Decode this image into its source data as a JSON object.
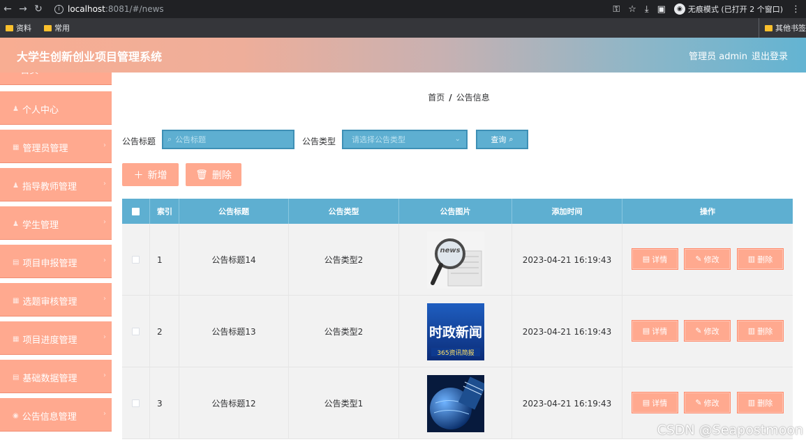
{
  "browser": {
    "url_host": "localhost",
    "url_path": ":8081/#/news",
    "incognito_label": "无痕模式 (已打开 2 个窗口)",
    "bookmarks": [
      "资料",
      "常用"
    ],
    "bookmarks_right": "其他书签"
  },
  "header": {
    "title": "大学生创新创业项目管理系统",
    "user": "管理员 admin",
    "logout": "退出登录"
  },
  "sidebar": {
    "items": [
      {
        "label": "首页",
        "icon": "home-icon"
      },
      {
        "label": "个人中心",
        "icon": "user-icon"
      },
      {
        "label": "管理员管理",
        "icon": "grid-icon"
      },
      {
        "label": "指导教师管理",
        "icon": "user-icon"
      },
      {
        "label": "学生管理",
        "icon": "user-icon"
      },
      {
        "label": "项目申报管理",
        "icon": "file-icon"
      },
      {
        "label": "选题审核管理",
        "icon": "grid-icon"
      },
      {
        "label": "项目进度管理",
        "icon": "grid-icon"
      },
      {
        "label": "基础数据管理",
        "icon": "file-icon"
      },
      {
        "label": "公告信息管理",
        "icon": "bell-icon"
      }
    ]
  },
  "breadcrumb": {
    "home": "首页",
    "sep": "/",
    "current": "公告信息"
  },
  "filters": {
    "title_label": "公告标题",
    "title_placeholder": "公告标题",
    "type_label": "公告类型",
    "type_placeholder": "请选择公告类型",
    "query_label": "查询"
  },
  "actions": {
    "add_label": "新增",
    "delete_label": "删除"
  },
  "table": {
    "columns": [
      "索引",
      "公告标题",
      "公告类型",
      "公告图片",
      "添加时间",
      "操作"
    ],
    "rows": [
      {
        "index": "1",
        "title": "公告标题14",
        "type": "公告类型2",
        "time": "2023-04-21 16:19:43",
        "image": "news-magnifier",
        "image_text": "news"
      },
      {
        "index": "2",
        "title": "公告标题13",
        "type": "公告类型2",
        "time": "2023-04-21 16:19:43",
        "image": "politics-news",
        "image_text": "时政新闻",
        "image_subtext": "365资讯简报"
      },
      {
        "index": "3",
        "title": "公告标题12",
        "type": "公告类型1",
        "time": "2023-04-21 16:19:43",
        "image": "globe-news"
      }
    ],
    "row_actions": {
      "detail": "详情",
      "edit": "修改",
      "delete": "删除"
    }
  },
  "watermark": "CSDN @Seapostmoon",
  "colors": {
    "accent": "#ffa98f",
    "table_header": "#5eafd1",
    "header_gradient_start": "#f8ad92",
    "header_gradient_end": "#63b4d2"
  }
}
